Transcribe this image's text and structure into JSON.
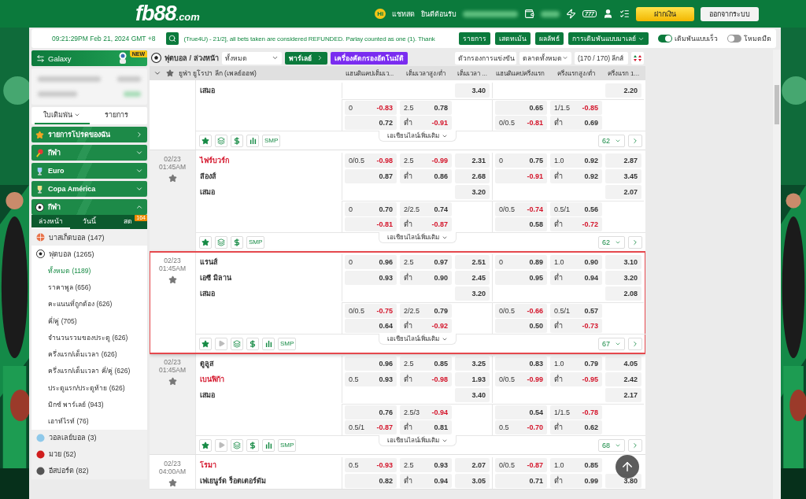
{
  "header": {
    "brand": "fb88",
    "brand_suffix": ".com",
    "chat_badge": "Hi",
    "chat": "แชทสด",
    "welcome": "ยินดีต้อนรับ",
    "slots": "777",
    "deposit": "ฝากเงิน",
    "logout": "ออกจากระบบ"
  },
  "topbar": {
    "clock": "09:21:29PM Feb 21, 2024 GMT +8",
    "announcement": "(True4U) - 21/2], all bets taken are considered REFUNDED. Parlay counted as one (1). Thank",
    "buttons": [
      {
        "label": "รายการ",
        "dropdown": false
      },
      {
        "label": "เสตทเม้น",
        "dropdown": false
      },
      {
        "label": "ผลลัพธ์",
        "dropdown": false
      },
      {
        "label": "การเดิมพันแบบมาเลย์",
        "dropdown": true
      }
    ],
    "toggles": [
      {
        "label": "เดิมพันแบบเร็ว",
        "on": true
      },
      {
        "label": "โหมดมืด",
        "on": false
      }
    ]
  },
  "sidebar": {
    "banner": {
      "label": "Galaxy",
      "ribbon": "NEW"
    },
    "tabs": [
      {
        "label": "ใบเดิมพัน",
        "selected": true,
        "dropdown": true
      },
      {
        "label": "รายการ",
        "selected": false,
        "dropdown": false
      }
    ],
    "menu": [
      {
        "label": "รายการโปรดของฉัน",
        "kind": "link"
      },
      {
        "label": "กีฬา",
        "kind": "section",
        "expanded": false
      },
      {
        "label": "Euro",
        "kind": "section",
        "expanded": false
      },
      {
        "label": "Copa América",
        "kind": "section",
        "expanded": false
      },
      {
        "label": "กีฬา",
        "kind": "section",
        "expanded": true
      }
    ],
    "sport_tabs": [
      {
        "label": "ล่วงหน้า",
        "selected": true
      },
      {
        "label": "วันนี้",
        "selected": false
      },
      {
        "label": "สด",
        "selected": false,
        "badge": "164"
      }
    ],
    "sports": [
      {
        "name": "บาสเก็ตบอล",
        "count": "(147)"
      },
      {
        "name": "ฟุตบอล",
        "count": "(1265)",
        "children": [
          {
            "name": "ทั้งหมด",
            "count": "(1189)",
            "selected": true
          },
          {
            "name": "ราคาพูล",
            "count": "(656)",
            "selected": false
          },
          {
            "name": "คะแนนที่ถูกต้อง",
            "count": "(626)",
            "selected": false
          },
          {
            "name": "คี่/คู่",
            "count": "(705)",
            "selected": false
          },
          {
            "name": "จำนวนรวมของประตู",
            "count": "(626)",
            "selected": false
          },
          {
            "name": "ครึ่งแรก/เต็มเวลา",
            "count": "(626)",
            "selected": false
          },
          {
            "name": "ครึ่งแรก/เต็มเวลา คี่/คู่",
            "count": "(626)",
            "selected": false
          },
          {
            "name": "ประตูแรก/ประตูท้าย",
            "count": "(626)",
            "selected": false
          },
          {
            "name": "มิกซ์ พาร์เลย์",
            "count": "(943)",
            "selected": false
          },
          {
            "name": "เอาท์ไรท์",
            "count": "(76)",
            "selected": false
          }
        ]
      },
      {
        "name": "วอลเลย์บอล",
        "count": "(3)"
      },
      {
        "name": "มวย",
        "count": "(52)"
      },
      {
        "name": "อีสปอร์ต",
        "count": "(82)"
      }
    ]
  },
  "toolbar": {
    "title": "ฟุตบอล / ล่วงหน้า",
    "select": "ทั้งหมด",
    "parlay": "พาร์เลย์",
    "auto_filter": "เครื่องคัดกรองอัตโนมัติ",
    "filters": [
      "ตัวกรองการแข่งขัน",
      "ตลาดทั้งหมด"
    ],
    "league_count": "(170 / 170) ลีกส์"
  },
  "table": {
    "league": "ยูฟ่า ยูโรปา ลีก (เพลย์ออฟ)",
    "columns": [
      "แฮนดิแคปเต็มเว...",
      "เต็มเวลาสูง/ต่ำ",
      "เต็มเวลา ...",
      "แฮนดิแคปครึ่งแรก",
      "ครึ่งแรกสูง/ต่ำ",
      "ครึ่งแรก 1..."
    ],
    "matches": [
      {
        "highlighted": false,
        "teams": [
          {
            "name": "เสมอ",
            "favorite": false
          }
        ],
        "rows": [
          [
            null,
            null,
            "3.40",
            null,
            null,
            "2.20"
          ]
        ],
        "alt_rows": [
          [
            [
              "0",
              "-0.83"
            ],
            [
              "2.5",
              "0.78"
            ],
            null,
            [
              "0.65"
            ],
            [
              "1/1.5",
              "-0.85"
            ],
            null
          ],
          [
            [
              "0.72"
            ],
            [
              "ต่ำ",
              "-0.91"
            ],
            null,
            [
              "0/0.5",
              "-0.81"
            ],
            [
              "ต่ำ",
              "0.69"
            ],
            null
          ]
        ],
        "tools": [
          {
            "kind": "favorite"
          },
          {
            "kind": "list"
          },
          {
            "kind": "cash"
          },
          {
            "kind": "stats"
          },
          {
            "kind": "label",
            "label": "SMP"
          }
        ],
        "more": "เอเชียนไลน์เพิ่มเติม",
        "count": "62"
      },
      {
        "highlighted": false,
        "date": "02/23",
        "time": "01:45AM",
        "teams": [
          {
            "name": "ไฟร์บวร์ก",
            "favorite": true
          },
          {
            "name": "ลีองส์",
            "favorite": false
          },
          {
            "name": "เสมอ",
            "favorite": false
          }
        ],
        "rows": [
          [
            [
              "0/0.5",
              "-0.98"
            ],
            [
              "2.5",
              "-0.99"
            ],
            "2.31",
            [
              "0",
              "0.75"
            ],
            [
              "1.0",
              "0.92"
            ],
            "2.87"
          ],
          [
            [
              "0.87"
            ],
            [
              "ต่ำ",
              "0.86"
            ],
            "2.68",
            [
              "-0.91"
            ],
            [
              "ต่ำ",
              "0.92"
            ],
            "3.45"
          ],
          [
            null,
            null,
            "3.20",
            null,
            null,
            "2.07"
          ]
        ],
        "alt_rows": [
          [
            [
              "0",
              "0.70"
            ],
            [
              "2/2.5",
              "0.74"
            ],
            null,
            [
              "0/0.5",
              "-0.74"
            ],
            [
              "0.5/1",
              "0.56"
            ],
            null
          ],
          [
            [
              "-0.81"
            ],
            [
              "ต่ำ",
              "-0.87"
            ],
            null,
            [
              "0.58"
            ],
            [
              "ต่ำ",
              "-0.72"
            ],
            null
          ]
        ],
        "tools": [
          {
            "kind": "favorite"
          },
          {
            "kind": "list"
          },
          {
            "kind": "cash"
          },
          {
            "kind": "label",
            "label": "SMP"
          }
        ],
        "more": "เอเชียนไลน์เพิ่มเติม",
        "count": "62"
      },
      {
        "highlighted": true,
        "date": "02/23",
        "time": "01:45AM",
        "teams": [
          {
            "name": "แรนส์",
            "favorite": false
          },
          {
            "name": "เอซี มิลาน",
            "favorite": false
          },
          {
            "name": "เสมอ",
            "favorite": false
          }
        ],
        "rows": [
          [
            [
              "0",
              "0.96"
            ],
            [
              "2.5",
              "0.97"
            ],
            "2.51",
            [
              "0",
              "0.89"
            ],
            [
              "1.0",
              "0.90"
            ],
            "3.10"
          ],
          [
            [
              "0.93"
            ],
            [
              "ต่ำ",
              "0.90"
            ],
            "2.45",
            [
              "0.95"
            ],
            [
              "ต่ำ",
              "0.94"
            ],
            "3.20"
          ],
          [
            null,
            null,
            "3.20",
            null,
            null,
            "2.08"
          ]
        ],
        "alt_rows": [
          [
            [
              "0/0.5",
              "-0.75"
            ],
            [
              "2/2.5",
              "0.79"
            ],
            null,
            [
              "0/0.5",
              "-0.66"
            ],
            [
              "0.5/1",
              "0.57"
            ],
            null
          ],
          [
            [
              "0.64"
            ],
            [
              "ต่ำ",
              "-0.92"
            ],
            null,
            [
              "0.50"
            ],
            [
              "ต่ำ",
              "-0.73"
            ],
            null
          ]
        ],
        "tools": [
          {
            "kind": "favorite"
          },
          {
            "kind": "play",
            "disabled": true
          },
          {
            "kind": "list"
          },
          {
            "kind": "cash"
          },
          {
            "kind": "stats"
          },
          {
            "kind": "label",
            "label": "SMP"
          }
        ],
        "more": "เอเชียนไลน์เพิ่มเติม",
        "count": "67"
      },
      {
        "highlighted": false,
        "date": "02/23",
        "time": "01:45AM",
        "teams": [
          {
            "name": "ตูลูส",
            "favorite": false
          },
          {
            "name": "เบนฟิก้า",
            "favorite": true
          },
          {
            "name": "เสมอ",
            "favorite": false
          }
        ],
        "rows": [
          [
            [
              "0.96"
            ],
            [
              "2.5",
              "0.85"
            ],
            "3.25",
            [
              "0.83"
            ],
            [
              "1.0",
              "0.79"
            ],
            "4.05"
          ],
          [
            [
              "0.5",
              "0.93"
            ],
            [
              "ต่ำ",
              "-0.98"
            ],
            "1.93",
            [
              "0/0.5",
              "-0.99"
            ],
            [
              "ต่ำ",
              "-0.95"
            ],
            "2.42"
          ],
          [
            null,
            null,
            "3.40",
            null,
            null,
            "2.17"
          ]
        ],
        "alt_rows": [
          [
            [
              "0.76"
            ],
            [
              "2.5/3",
              "-0.94"
            ],
            null,
            [
              "0.54"
            ],
            [
              "1/1.5",
              "-0.78"
            ],
            null
          ],
          [
            [
              "0.5/1",
              "-0.87"
            ],
            [
              "ต่ำ",
              "0.81"
            ],
            null,
            [
              "0.5",
              "-0.70"
            ],
            [
              "ต่ำ",
              "0.62"
            ],
            null
          ]
        ],
        "tools": [
          {
            "kind": "favorite"
          },
          {
            "kind": "play",
            "disabled": true
          },
          {
            "kind": "list"
          },
          {
            "kind": "cash"
          },
          {
            "kind": "stats"
          },
          {
            "kind": "label",
            "label": "SMP"
          }
        ],
        "more": "เอเชียนไลน์เพิ่มเติม",
        "count": "68"
      },
      {
        "highlighted": false,
        "date": "02/23",
        "time": "04:00AM",
        "teams": [
          {
            "name": "โรมา",
            "favorite": true
          },
          {
            "name": "เฟเยนูร์ด ร็อตเตอร์ดัม",
            "favorite": false
          }
        ],
        "rows": [
          [
            [
              "0.5",
              "-0.93"
            ],
            [
              "2.5",
              "0.93"
            ],
            "2.07",
            [
              "0/0.5",
              "-0.87"
            ],
            [
              "1.0",
              "0.85"
            ],
            null
          ],
          [
            [
              "0.82"
            ],
            [
              "ต่ำ",
              "0.94"
            ],
            "3.05",
            [
              "0.71"
            ],
            [
              "ต่ำ",
              "0.99"
            ],
            "3.80"
          ]
        ]
      }
    ]
  }
}
